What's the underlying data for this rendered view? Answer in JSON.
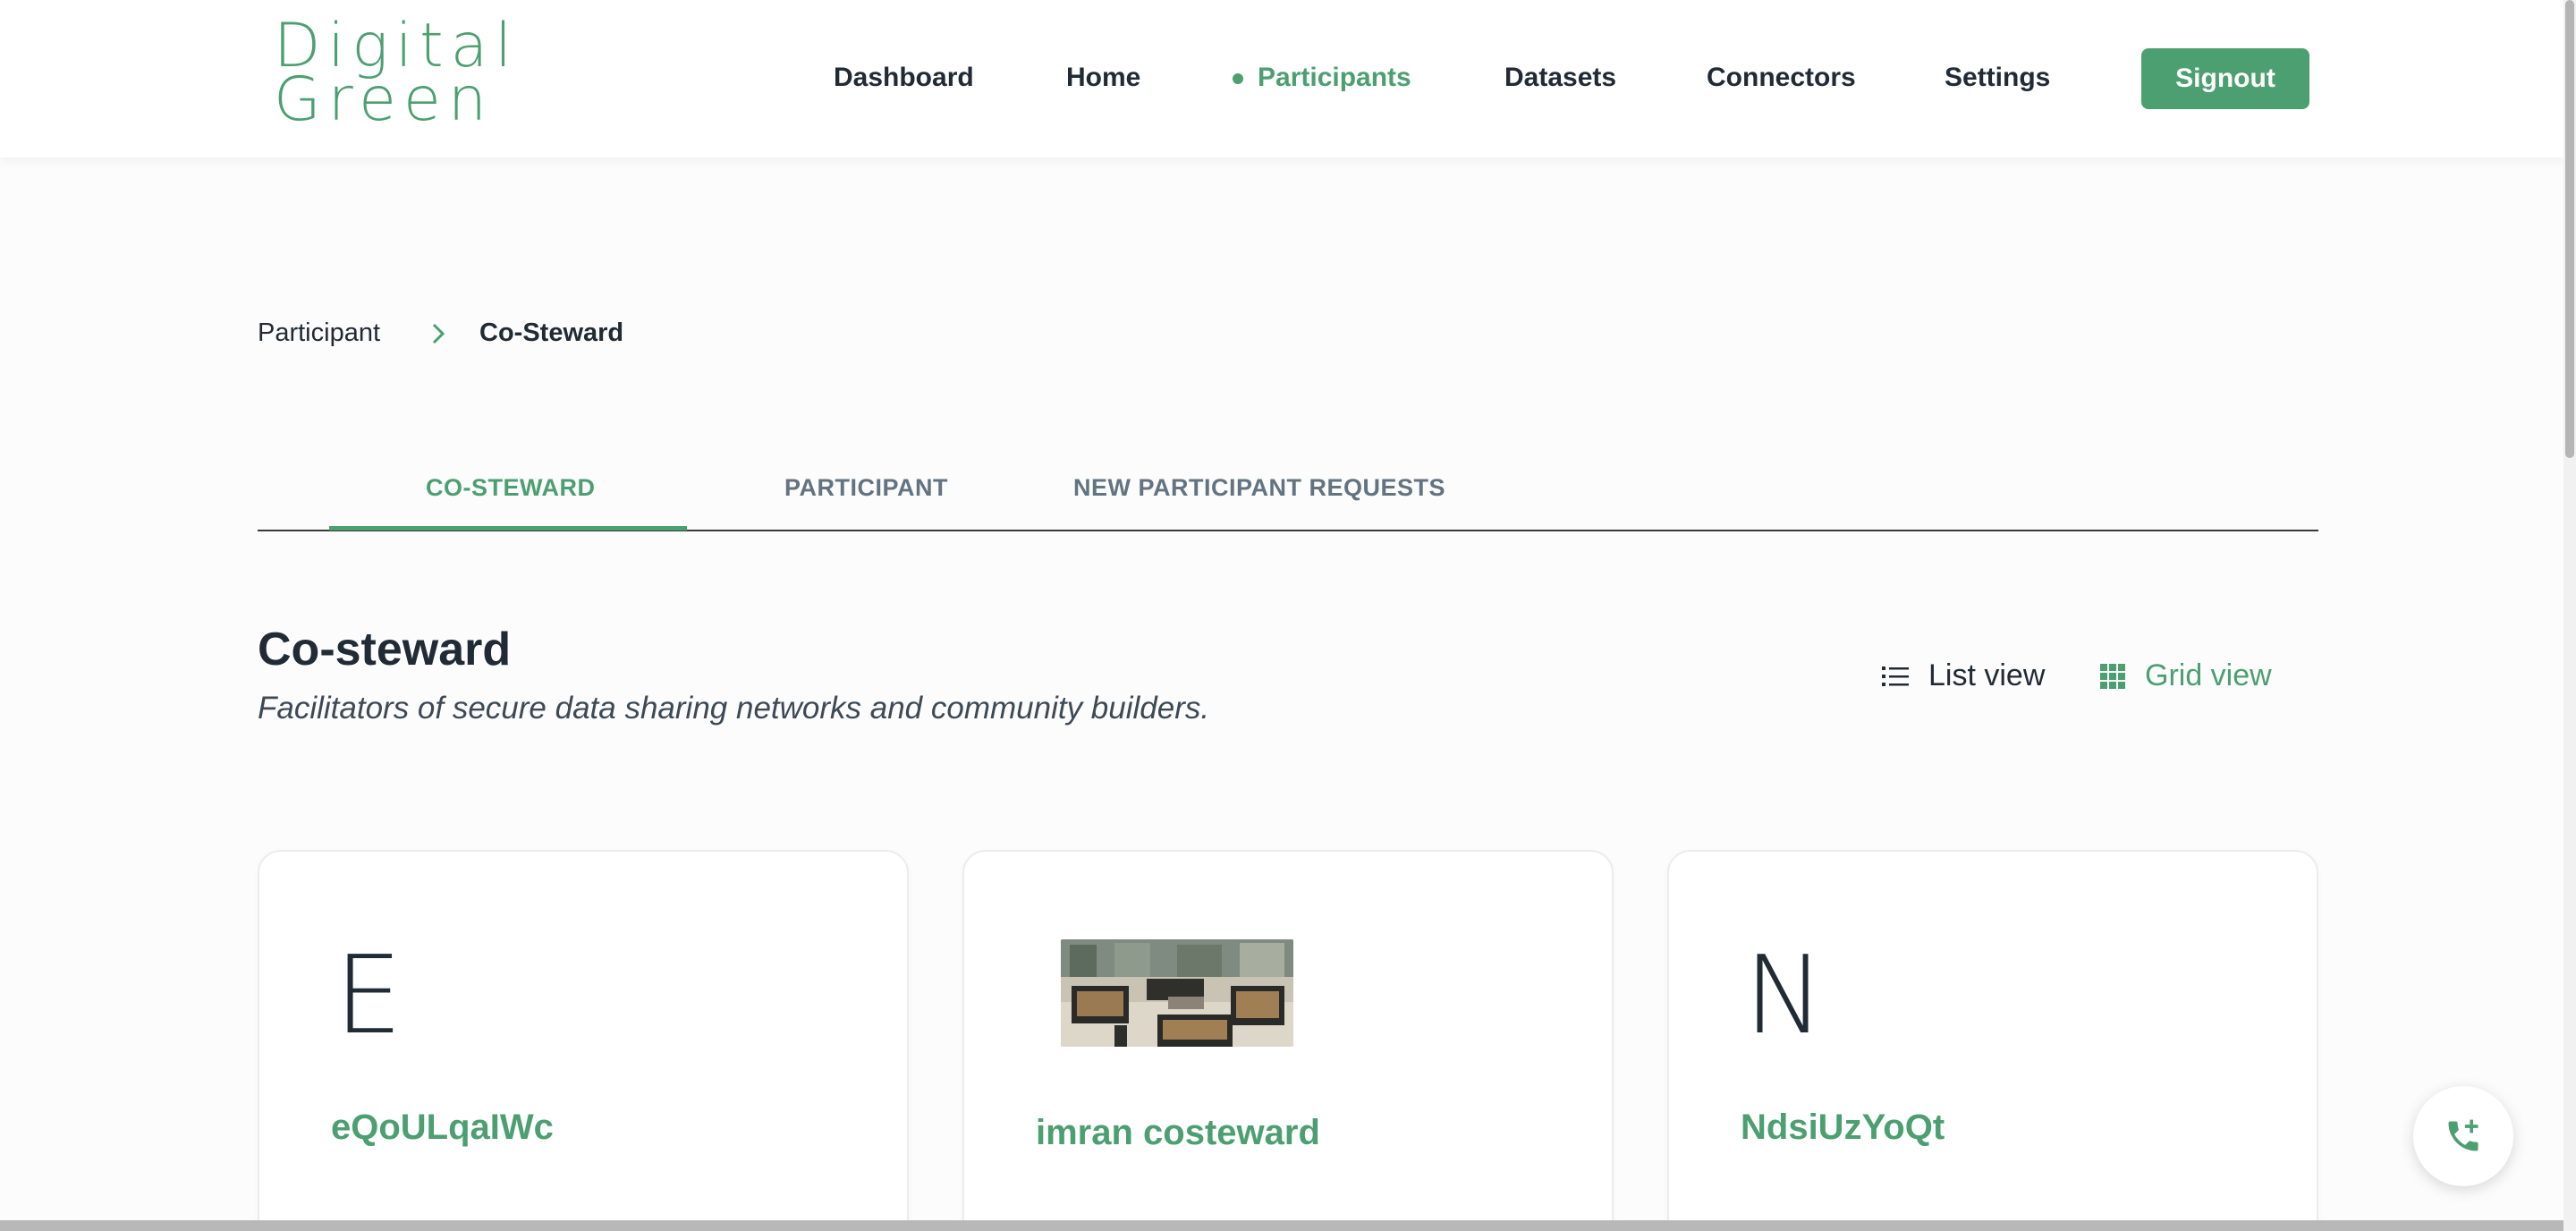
{
  "brand": {
    "logo_line1": "Digital",
    "logo_line2": "Green",
    "accent_color": "#4c9f70"
  },
  "nav": {
    "items": [
      {
        "label": "Dashboard",
        "active": false
      },
      {
        "label": "Home",
        "active": false
      },
      {
        "label": "Participants",
        "active": true
      },
      {
        "label": "Datasets",
        "active": false
      },
      {
        "label": "Connectors",
        "active": false
      },
      {
        "label": "Settings",
        "active": false
      }
    ],
    "signout_label": "Signout"
  },
  "breadcrumb": {
    "parent": "Participant",
    "current": "Co-Steward"
  },
  "tabs": [
    {
      "label": "CO-STEWARD",
      "active": true
    },
    {
      "label": "PARTICIPANT",
      "active": false
    },
    {
      "label": "NEW PARTICIPANT REQUESTS",
      "active": false
    }
  ],
  "section": {
    "title": "Co-steward",
    "subtitle": "Facilitators of secure data sharing networks and community builders."
  },
  "view_toggle": {
    "list_label": "List view",
    "grid_label": "Grid view",
    "selected": "grid"
  },
  "cards": [
    {
      "avatar_letter": "E",
      "name": "eQoULqaIWc",
      "has_image": false
    },
    {
      "avatar_letter": "",
      "name": "imran costeward",
      "has_image": true
    },
    {
      "avatar_letter": "N",
      "name": "NdsiUzYoQt",
      "has_image": false
    }
  ],
  "fab": {
    "icon": "phone-plus-icon"
  }
}
